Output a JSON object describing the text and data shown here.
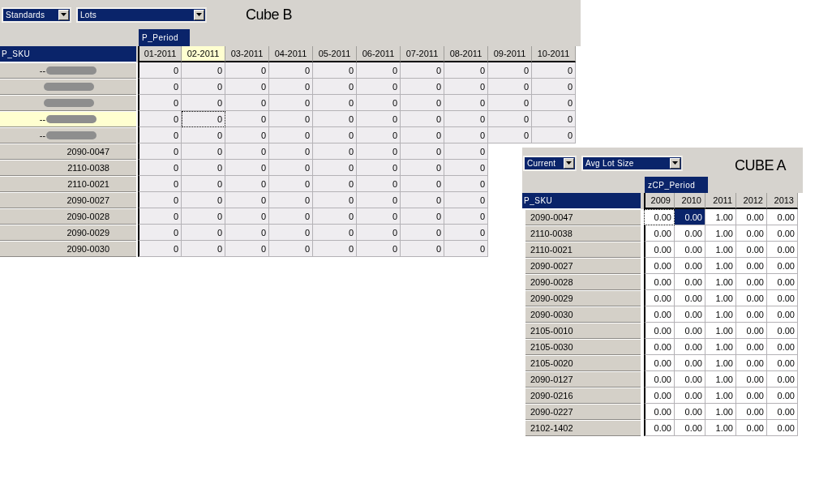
{
  "cube_b": {
    "title": "Cube B",
    "dropdowns": [
      {
        "value": "Standards"
      },
      {
        "value": "Lots"
      }
    ],
    "column_dimension": "P_Period",
    "row_dimension": "P_SKU",
    "columns": [
      {
        "label": "01-2011",
        "selected": false
      },
      {
        "label": "02-2011",
        "selected": true
      },
      {
        "label": "03-2011",
        "selected": false
      },
      {
        "label": "04-2011",
        "selected": false
      },
      {
        "label": "05-2011",
        "selected": false
      },
      {
        "label": "06-2011",
        "selected": false
      },
      {
        "label": "07-2011",
        "selected": false
      },
      {
        "label": "08-2011",
        "selected": false
      },
      {
        "label": "09-2011",
        "selected": false
      },
      {
        "label": "10-2011",
        "selected": false
      }
    ],
    "rows": [
      {
        "kind": "group",
        "label": "--",
        "redacted": true,
        "selected": false,
        "cells": [
          {
            "value": "0",
            "focused": false
          },
          {
            "value": "0",
            "focused": false
          },
          {
            "value": "0",
            "focused": false
          },
          {
            "value": "0",
            "focused": false
          },
          {
            "value": "0",
            "focused": false
          },
          {
            "value": "0",
            "focused": false
          },
          {
            "value": "0",
            "focused": false
          },
          {
            "value": "0",
            "focused": false
          },
          {
            "value": "0",
            "focused": false
          },
          {
            "value": "0",
            "focused": false
          }
        ]
      },
      {
        "kind": "group",
        "redacted": true,
        "selected": false,
        "cells": [
          {
            "value": "0",
            "focused": false
          },
          {
            "value": "0",
            "focused": false
          },
          {
            "value": "0",
            "focused": false
          },
          {
            "value": "0",
            "focused": false
          },
          {
            "value": "0",
            "focused": false
          },
          {
            "value": "0",
            "focused": false
          },
          {
            "value": "0",
            "focused": false
          },
          {
            "value": "0",
            "focused": false
          },
          {
            "value": "0",
            "focused": false
          },
          {
            "value": "0",
            "focused": false
          }
        ]
      },
      {
        "kind": "group",
        "redacted": true,
        "selected": false,
        "cells": [
          {
            "value": "0",
            "focused": false
          },
          {
            "value": "0",
            "focused": false
          },
          {
            "value": "0",
            "focused": false
          },
          {
            "value": "0",
            "focused": false
          },
          {
            "value": "0",
            "focused": false
          },
          {
            "value": "0",
            "focused": false
          },
          {
            "value": "0",
            "focused": false
          },
          {
            "value": "0",
            "focused": false
          },
          {
            "value": "0",
            "focused": false
          },
          {
            "value": "0",
            "focused": false
          }
        ]
      },
      {
        "kind": "group",
        "label": "--",
        "redacted": true,
        "selected": true,
        "cells": [
          {
            "value": "0",
            "focused": false
          },
          {
            "value": "0",
            "focused": true
          },
          {
            "value": "0",
            "focused": false
          },
          {
            "value": "0",
            "focused": false
          },
          {
            "value": "0",
            "focused": false
          },
          {
            "value": "0",
            "focused": false
          },
          {
            "value": "0",
            "focused": false
          },
          {
            "value": "0",
            "focused": false
          },
          {
            "value": "0",
            "focused": false
          },
          {
            "value": "0",
            "focused": false
          }
        ]
      },
      {
        "kind": "group",
        "label": "--",
        "redacted": true,
        "selected": false,
        "cells": [
          {
            "value": "0",
            "focused": false
          },
          {
            "value": "0",
            "focused": false
          },
          {
            "value": "0",
            "focused": false
          },
          {
            "value": "0",
            "focused": false
          },
          {
            "value": "0",
            "focused": false
          },
          {
            "value": "0",
            "focused": false
          },
          {
            "value": "0",
            "focused": false
          },
          {
            "value": "0",
            "focused": false
          },
          {
            "value": "0",
            "focused": false
          },
          {
            "value": "0",
            "focused": false
          }
        ]
      },
      {
        "kind": "sku",
        "label": "2090-0047",
        "selected": false,
        "cells": [
          {
            "value": "0",
            "focused": false
          },
          {
            "value": "0",
            "focused": false
          },
          {
            "value": "0",
            "focused": false
          },
          {
            "value": "0",
            "focused": false
          },
          {
            "value": "0",
            "focused": false
          },
          {
            "value": "0",
            "focused": false
          },
          {
            "value": "0",
            "focused": false
          },
          {
            "value": "0",
            "focused": false
          }
        ]
      },
      {
        "kind": "sku",
        "label": "2110-0038",
        "selected": false,
        "cells": [
          {
            "value": "0",
            "focused": false
          },
          {
            "value": "0",
            "focused": false
          },
          {
            "value": "0",
            "focused": false
          },
          {
            "value": "0",
            "focused": false
          },
          {
            "value": "0",
            "focused": false
          },
          {
            "value": "0",
            "focused": false
          },
          {
            "value": "0",
            "focused": false
          },
          {
            "value": "0",
            "focused": false
          }
        ]
      },
      {
        "kind": "sku",
        "label": "2110-0021",
        "selected": false,
        "cells": [
          {
            "value": "0",
            "focused": false
          },
          {
            "value": "0",
            "focused": false
          },
          {
            "value": "0",
            "focused": false
          },
          {
            "value": "0",
            "focused": false
          },
          {
            "value": "0",
            "focused": false
          },
          {
            "value": "0",
            "focused": false
          },
          {
            "value": "0",
            "focused": false
          },
          {
            "value": "0",
            "focused": false
          }
        ]
      },
      {
        "kind": "sku",
        "label": "2090-0027",
        "selected": false,
        "cells": [
          {
            "value": "0",
            "focused": false
          },
          {
            "value": "0",
            "focused": false
          },
          {
            "value": "0",
            "focused": false
          },
          {
            "value": "0",
            "focused": false
          },
          {
            "value": "0",
            "focused": false
          },
          {
            "value": "0",
            "focused": false
          },
          {
            "value": "0",
            "focused": false
          },
          {
            "value": "0",
            "focused": false
          }
        ]
      },
      {
        "kind": "sku",
        "label": "2090-0028",
        "selected": false,
        "cells": [
          {
            "value": "0",
            "focused": false
          },
          {
            "value": "0",
            "focused": false
          },
          {
            "value": "0",
            "focused": false
          },
          {
            "value": "0",
            "focused": false
          },
          {
            "value": "0",
            "focused": false
          },
          {
            "value": "0",
            "focused": false
          },
          {
            "value": "0",
            "focused": false
          },
          {
            "value": "0",
            "focused": false
          }
        ]
      },
      {
        "kind": "sku",
        "label": "2090-0029",
        "selected": false,
        "cells": [
          {
            "value": "0",
            "focused": false
          },
          {
            "value": "0",
            "focused": false
          },
          {
            "value": "0",
            "focused": false
          },
          {
            "value": "0",
            "focused": false
          },
          {
            "value": "0",
            "focused": false
          },
          {
            "value": "0",
            "focused": false
          },
          {
            "value": "0",
            "focused": false
          },
          {
            "value": "0",
            "focused": false
          }
        ]
      },
      {
        "kind": "sku",
        "label": "2090-0030",
        "selected": false,
        "cells": [
          {
            "value": "0",
            "focused": false
          },
          {
            "value": "0",
            "focused": false
          },
          {
            "value": "0",
            "focused": false
          },
          {
            "value": "0",
            "focused": false
          },
          {
            "value": "0",
            "focused": false
          },
          {
            "value": "0",
            "focused": false
          },
          {
            "value": "0",
            "focused": false
          },
          {
            "value": "0",
            "focused": false
          }
        ]
      }
    ]
  },
  "cube_a": {
    "title": "CUBE A",
    "dropdowns": [
      {
        "value": "Current"
      },
      {
        "value": "Avg Lot Size"
      }
    ],
    "column_dimension": "zCP_Period",
    "row_dimension": "P_SKU",
    "columns": [
      {
        "label": "2009",
        "selected": false
      },
      {
        "label": "2010",
        "selected": false
      },
      {
        "label": "2011",
        "selected": false
      },
      {
        "label": "2012",
        "selected": false
      },
      {
        "label": "2013",
        "selected": false
      }
    ],
    "rows": [
      {
        "kind": "sku",
        "label": "2090-0047",
        "selected": false,
        "cells": [
          {
            "value": "0.00",
            "focused": true,
            "selected": false
          },
          {
            "value": "0.00",
            "focused": false,
            "selected": true
          },
          {
            "value": "1.00",
            "focused": false,
            "selected": false
          },
          {
            "value": "0.00",
            "focused": false,
            "selected": false
          },
          {
            "value": "0.00",
            "focused": false,
            "selected": false
          }
        ]
      },
      {
        "kind": "sku",
        "label": "2110-0038",
        "selected": false,
        "cells": [
          {
            "value": "0.00",
            "focused": false,
            "selected": false
          },
          {
            "value": "0.00",
            "focused": false,
            "selected": false
          },
          {
            "value": "1.00",
            "focused": false,
            "selected": false
          },
          {
            "value": "0.00",
            "focused": false,
            "selected": false
          },
          {
            "value": "0.00",
            "focused": false,
            "selected": false
          }
        ]
      },
      {
        "kind": "sku",
        "label": "2110-0021",
        "selected": false,
        "cells": [
          {
            "value": "0.00",
            "focused": false,
            "selected": false
          },
          {
            "value": "0.00",
            "focused": false,
            "selected": false
          },
          {
            "value": "1.00",
            "focused": false,
            "selected": false
          },
          {
            "value": "0.00",
            "focused": false,
            "selected": false
          },
          {
            "value": "0.00",
            "focused": false,
            "selected": false
          }
        ]
      },
      {
        "kind": "sku",
        "label": "2090-0027",
        "selected": false,
        "cells": [
          {
            "value": "0.00",
            "focused": false,
            "selected": false
          },
          {
            "value": "0.00",
            "focused": false,
            "selected": false
          },
          {
            "value": "1.00",
            "focused": false,
            "selected": false
          },
          {
            "value": "0.00",
            "focused": false,
            "selected": false
          },
          {
            "value": "0.00",
            "focused": false,
            "selected": false
          }
        ]
      },
      {
        "kind": "sku",
        "label": "2090-0028",
        "selected": false,
        "cells": [
          {
            "value": "0.00",
            "focused": false,
            "selected": false
          },
          {
            "value": "0.00",
            "focused": false,
            "selected": false
          },
          {
            "value": "1.00",
            "focused": false,
            "selected": false
          },
          {
            "value": "0.00",
            "focused": false,
            "selected": false
          },
          {
            "value": "0.00",
            "focused": false,
            "selected": false
          }
        ]
      },
      {
        "kind": "sku",
        "label": "2090-0029",
        "selected": false,
        "cells": [
          {
            "value": "0.00",
            "focused": false,
            "selected": false
          },
          {
            "value": "0.00",
            "focused": false,
            "selected": false
          },
          {
            "value": "1.00",
            "focused": false,
            "selected": false
          },
          {
            "value": "0.00",
            "focused": false,
            "selected": false
          },
          {
            "value": "0.00",
            "focused": false,
            "selected": false
          }
        ]
      },
      {
        "kind": "sku",
        "label": "2090-0030",
        "selected": false,
        "cells": [
          {
            "value": "0.00",
            "focused": false,
            "selected": false
          },
          {
            "value": "0.00",
            "focused": false,
            "selected": false
          },
          {
            "value": "1.00",
            "focused": false,
            "selected": false
          },
          {
            "value": "0.00",
            "focused": false,
            "selected": false
          },
          {
            "value": "0.00",
            "focused": false,
            "selected": false
          }
        ]
      },
      {
        "kind": "sku",
        "label": "2105-0010",
        "selected": false,
        "cells": [
          {
            "value": "0.00",
            "focused": false,
            "selected": false
          },
          {
            "value": "0.00",
            "focused": false,
            "selected": false
          },
          {
            "value": "1.00",
            "focused": false,
            "selected": false
          },
          {
            "value": "0.00",
            "focused": false,
            "selected": false
          },
          {
            "value": "0.00",
            "focused": false,
            "selected": false
          }
        ]
      },
      {
        "kind": "sku",
        "label": "2105-0030",
        "selected": false,
        "cells": [
          {
            "value": "0.00",
            "focused": false,
            "selected": false
          },
          {
            "value": "0.00",
            "focused": false,
            "selected": false
          },
          {
            "value": "1.00",
            "focused": false,
            "selected": false
          },
          {
            "value": "0.00",
            "focused": false,
            "selected": false
          },
          {
            "value": "0.00",
            "focused": false,
            "selected": false
          }
        ]
      },
      {
        "kind": "sku",
        "label": "2105-0020",
        "selected": false,
        "cells": [
          {
            "value": "0.00",
            "focused": false,
            "selected": false
          },
          {
            "value": "0.00",
            "focused": false,
            "selected": false
          },
          {
            "value": "1.00",
            "focused": false,
            "selected": false
          },
          {
            "value": "0.00",
            "focused": false,
            "selected": false
          },
          {
            "value": "0.00",
            "focused": false,
            "selected": false
          }
        ]
      },
      {
        "kind": "sku",
        "label": "2090-0127",
        "selected": false,
        "cells": [
          {
            "value": "0.00",
            "focused": false,
            "selected": false
          },
          {
            "value": "0.00",
            "focused": false,
            "selected": false
          },
          {
            "value": "1.00",
            "focused": false,
            "selected": false
          },
          {
            "value": "0.00",
            "focused": false,
            "selected": false
          },
          {
            "value": "0.00",
            "focused": false,
            "selected": false
          }
        ]
      },
      {
        "kind": "sku",
        "label": "2090-0216",
        "selected": false,
        "cells": [
          {
            "value": "0.00",
            "focused": false,
            "selected": false
          },
          {
            "value": "0.00",
            "focused": false,
            "selected": false
          },
          {
            "value": "1.00",
            "focused": false,
            "selected": false
          },
          {
            "value": "0.00",
            "focused": false,
            "selected": false
          },
          {
            "value": "0.00",
            "focused": false,
            "selected": false
          }
        ]
      },
      {
        "kind": "sku",
        "label": "2090-0227",
        "selected": false,
        "cells": [
          {
            "value": "0.00",
            "focused": false,
            "selected": false
          },
          {
            "value": "0.00",
            "focused": false,
            "selected": false
          },
          {
            "value": "1.00",
            "focused": false,
            "selected": false
          },
          {
            "value": "0.00",
            "focused": false,
            "selected": false
          },
          {
            "value": "0.00",
            "focused": false,
            "selected": false
          }
        ]
      },
      {
        "kind": "sku",
        "label": "2102-1402",
        "selected": false,
        "cells": [
          {
            "value": "0.00",
            "focused": false,
            "selected": false
          },
          {
            "value": "0.00",
            "focused": false,
            "selected": false
          },
          {
            "value": "1.00",
            "focused": false,
            "selected": false
          },
          {
            "value": "0.00",
            "focused": false,
            "selected": false
          },
          {
            "value": "0.00",
            "focused": false,
            "selected": false
          }
        ]
      }
    ]
  }
}
